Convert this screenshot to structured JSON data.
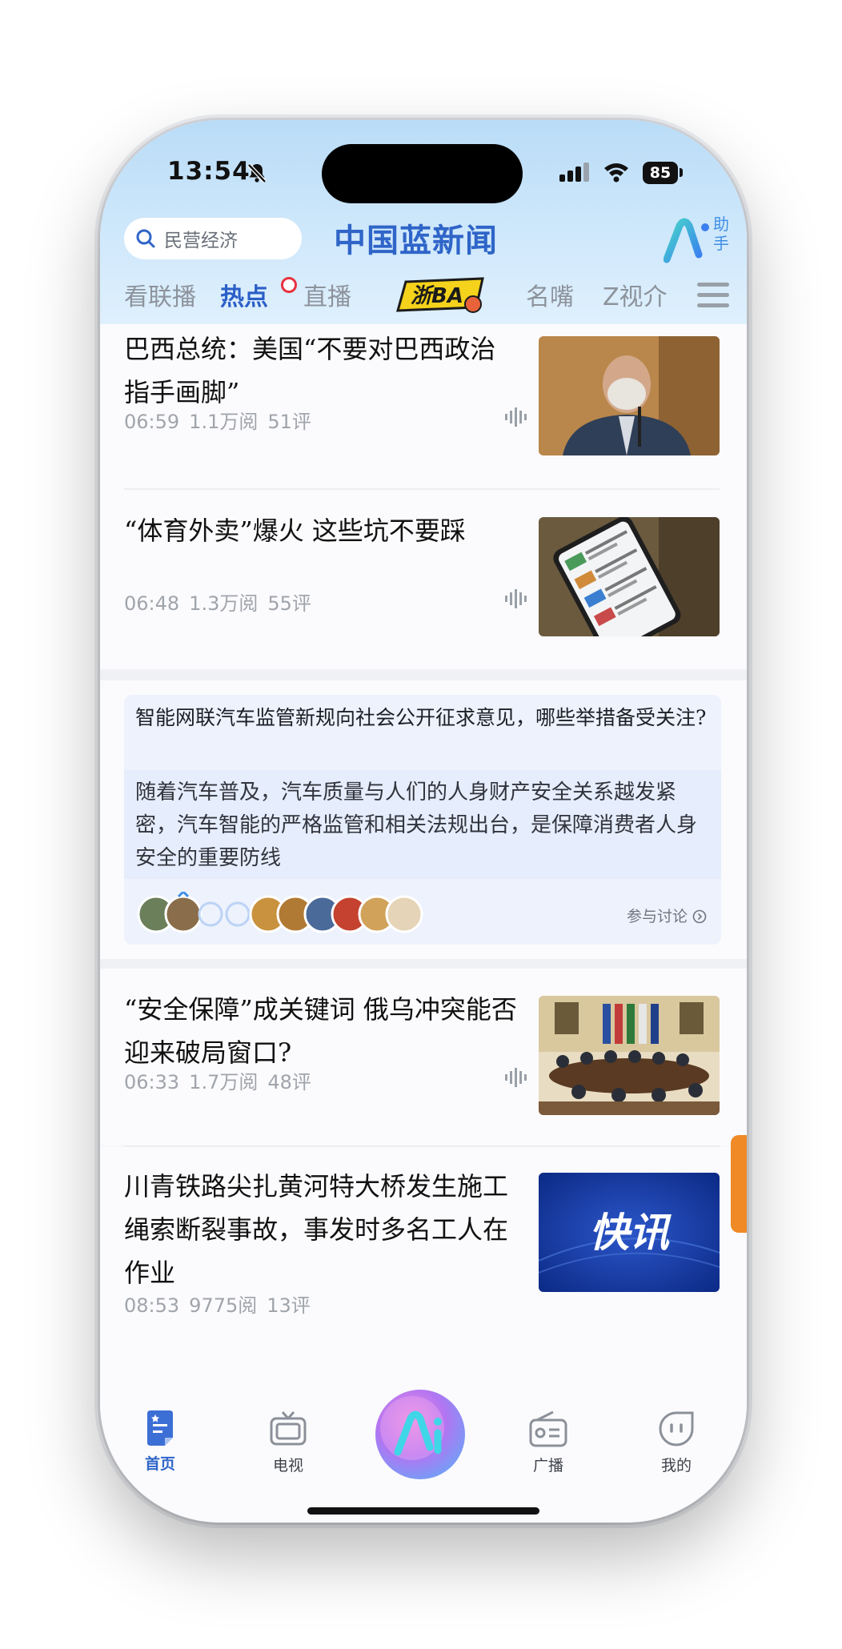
{
  "status_bar": {
    "time": "13:54",
    "battery": "85"
  },
  "header": {
    "search_placeholder": "民营经济",
    "logo_text": "中国蓝新闻",
    "assistant_label": "助手",
    "tabs": [
      {
        "label": "看联播",
        "active": false
      },
      {
        "label": "热点",
        "active": true
      },
      {
        "label": "直播",
        "active": false
      },
      {
        "label": "名嘴",
        "active": false
      },
      {
        "label": "Z视介",
        "active": false
      }
    ],
    "special_tab_logo": "浙BA"
  },
  "news": [
    {
      "title": "巴西总统：美国“不要对巴西政治指手画脚”",
      "time": "06:59",
      "reads": "1.1万阅",
      "comments": "51评",
      "thumb": "portrait-photo"
    },
    {
      "title": "“体育外卖”爆火  这些坑不要踩",
      "time": "06:48",
      "reads": "1.3万阅",
      "comments": "55评",
      "thumb": "phone-app-photo"
    },
    {
      "title": "“安全保障”成关键词  俄乌冲突能否迎来破局窗口?",
      "time": "06:33",
      "reads": "1.7万阅",
      "comments": "48评",
      "thumb": "meeting-photo"
    },
    {
      "title": "川青铁路尖扎黄河特大桥发生施工绳索断裂事故，事发时多名工人在作业",
      "time": "08:53",
      "reads": "9775阅",
      "comments": "13评",
      "thumb": "flash-news",
      "thumb_text": "快讯"
    }
  ],
  "topic": {
    "question": "智能网联汽车监管新规向社会公开征求意见，哪些举措备受关注?",
    "answer": "随着汽车普及，汽车质量与人们的人身财产安全关系越发紧密，汽车智能的严格监管和相关法规出台，是保障消费者人身安全的重要防线",
    "join_label": "参与讨论"
  },
  "tabbar": [
    {
      "label": "首页",
      "icon": "home-doc-icon",
      "active": true
    },
    {
      "label": "电视",
      "icon": "tv-icon",
      "active": false
    },
    {
      "label": "",
      "icon": "ai-center-icon",
      "active": false
    },
    {
      "label": "广播",
      "icon": "radio-icon",
      "active": false
    },
    {
      "label": "我的",
      "icon": "face-icon",
      "active": false
    }
  ],
  "colors": {
    "brand_blue": "#2f65c8",
    "accent_red": "#e8323f",
    "header_bg": "#b9dcf7"
  }
}
